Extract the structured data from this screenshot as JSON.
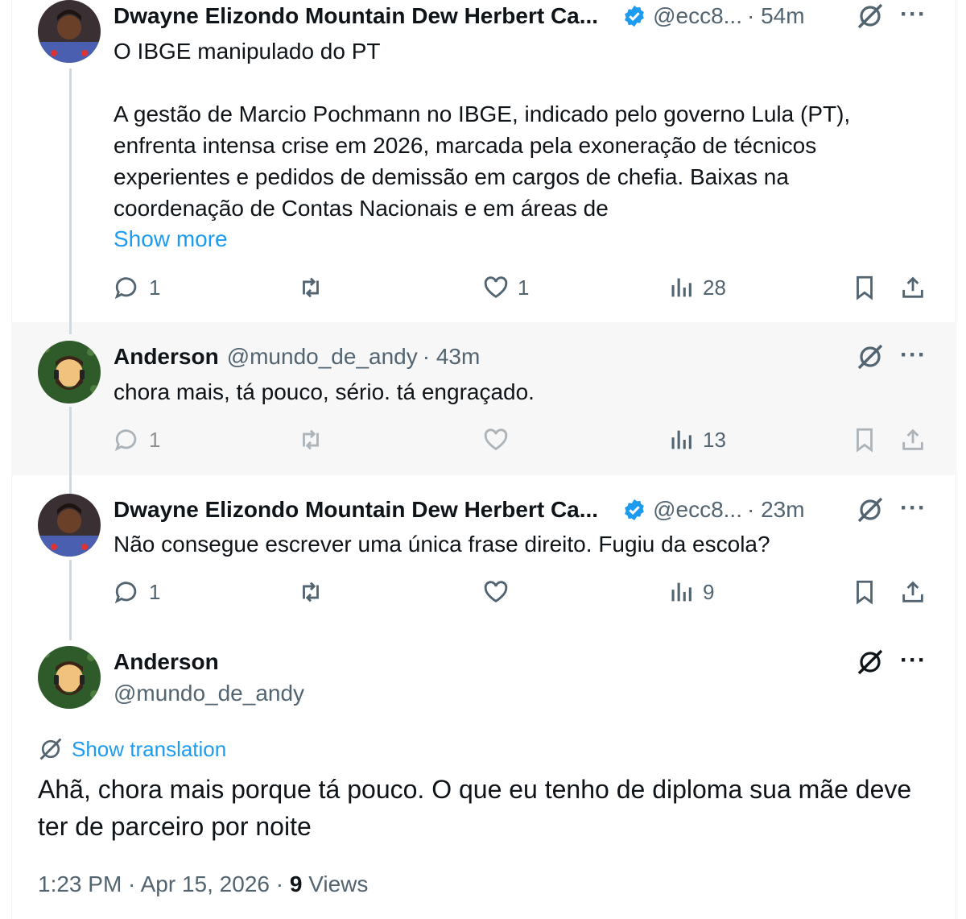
{
  "tweets": [
    {
      "name": "Dwayne Elizondo Mountain Dew Herbert Ca...",
      "handle": "@ecc8...",
      "time": "· 54m",
      "text": "O IBGE manipulado do PT\n\nA gestão de Marcio Pochmann no IBGE, indicado pelo governo Lula (PT), enfrenta intensa crise em 2026, marcada pela exoneração de técnicos experientes e pedidos de demissão em cargos de chefia. Baixas na coordenação de Contas Nacionais e em áreas de",
      "show_more": "Show more",
      "replies": "1",
      "reposts": "",
      "likes": "1",
      "views": "28"
    },
    {
      "name": "Anderson",
      "handle": "@mundo_de_andy",
      "time": "· 43m",
      "text": "chora mais, tá pouco, sério. tá engraçado.",
      "replies": "1",
      "reposts": "",
      "likes": "",
      "views": "13"
    },
    {
      "name": "Dwayne Elizondo Mountain Dew Herbert Ca...",
      "handle": "@ecc8...",
      "time": "· 23m",
      "text": "Não consegue escrever uma única frase direito. Fugiu da escola?",
      "replies": "1",
      "reposts": "",
      "likes": "",
      "views": "9"
    }
  ],
  "focused": {
    "name": "Anderson",
    "handle": "@mundo_de_andy",
    "translation_label": "Show translation",
    "text": "Ahã, chora mais porque tá pouco. O que eu tenho de diploma sua mãe deve ter de parceiro por noite",
    "timestamp": "1:23 PM · Apr 15, 2026 · ",
    "views_count": "9",
    "views_label": " Views"
  },
  "colors": {
    "accent": "#1d9bf0",
    "muted_text": "#536471",
    "text": "#0f1419",
    "thread_line": "#cfd9de",
    "highlight_bg": "#f7f7f7"
  },
  "icons": [
    "reply-icon",
    "repost-icon",
    "like-icon",
    "views-icon",
    "bookmark-icon",
    "share-icon",
    "grok-icon",
    "more-icon",
    "verified-icon",
    "translate-icon"
  ]
}
